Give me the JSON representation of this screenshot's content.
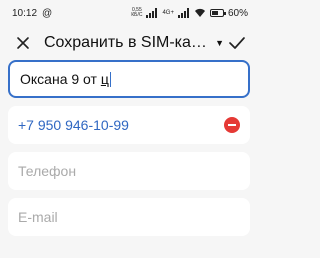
{
  "status_bar": {
    "time": "10:12",
    "at_icon": "@",
    "speed_value": "0,55",
    "speed_unit": "КБ/С",
    "network": "4G+",
    "battery_percent": "60%",
    "battery_level": 0.6
  },
  "toolbar": {
    "title": "Сохранить в SIM-карт…",
    "caret": "▼"
  },
  "form": {
    "name_value_main": "Оксана 9 от ",
    "name_value_last": "ц",
    "phone_value": "+7 950 946-10-99",
    "phone2_placeholder": "Телефон",
    "email_placeholder": "E-mail"
  },
  "colors": {
    "accent": "#3670c9",
    "remove": "#e53935"
  }
}
